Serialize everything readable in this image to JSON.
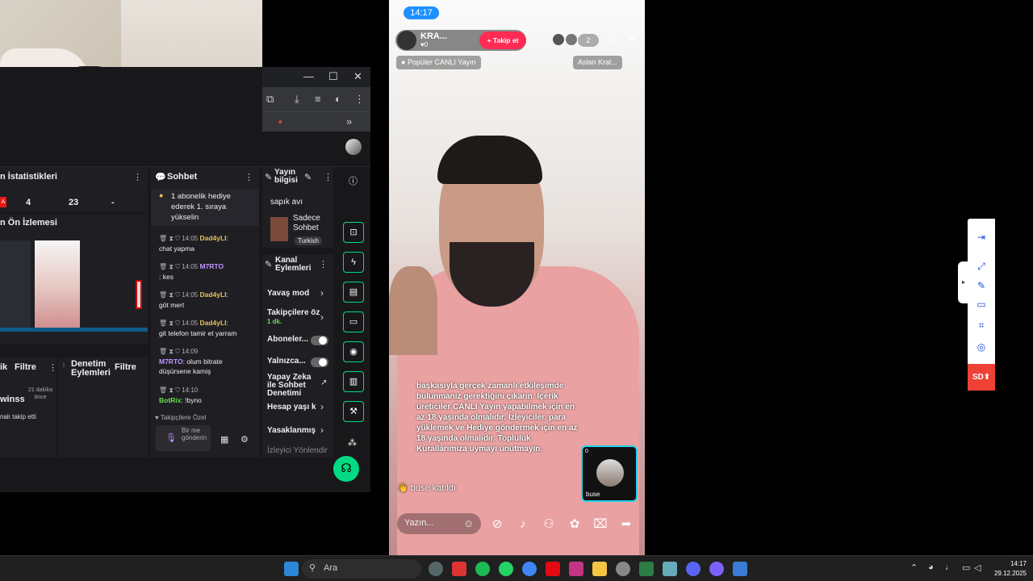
{
  "dashboard": {
    "stats_title": "n İstatistikleri",
    "stats": [
      "4",
      "23",
      "-"
    ],
    "live_badge": "A",
    "preview_title": "n Ön İzlemesi",
    "filter_label": "Filtre",
    "filter_left": "ik",
    "denetim_title": "Denetim Eylemleri",
    "activity_user": "winss",
    "activity_time": "21 dakika önce",
    "activity_text": "nalı takip etti"
  },
  "chat": {
    "title": "Sohbet",
    "pinned": "1 abonelik hediye ederek 1. sıraya yükselin",
    "messages": [
      {
        "time": "14:05",
        "user": "Dad4yLI",
        "text": "chat yapma",
        "color": "y"
      },
      {
        "time": "14:05",
        "user": "M7RTO",
        "text": ": kes",
        "color": "p"
      },
      {
        "time": "14:05",
        "user": "Dad4yLI",
        "text": "göt mert",
        "color": "y"
      },
      {
        "time": "14:05",
        "user": "Dad4yLI",
        "text": "git telefon tamir et yarram",
        "color": "y"
      },
      {
        "time": "14:09",
        "user": "M7RTO",
        "text": ": olum bitrate düşürsene kamiş",
        "color": "p"
      },
      {
        "time": "14:10",
        "user": "BotRix",
        "text": ": !byno",
        "color": "g"
      }
    ],
    "followers_only": "Takipçilere Özel",
    "input_placeholder": "Bir me gönderin"
  },
  "stream_info": {
    "title": "Yayın bilgisi",
    "stream_name": "sapık avı",
    "category": "Sadece Sohbet",
    "language": "Turkish"
  },
  "channel_actions": {
    "title": "Kanal Eylemleri",
    "slow_mode": "Yavaş mod",
    "followers": "Takipçilere öz",
    "followers_sub": "1 dk.",
    "subscribers": "Aboneler...",
    "only": "Yalnızca...",
    "ai_moderation": "Yapay Zeka ile Sohbet Denetimi",
    "account_age": "Hesap yaşı k",
    "banned": "Yasaklanmış",
    "viewer_redirect": "İzleyici Yönlendir"
  },
  "phone": {
    "time": "14:17",
    "streamer": "KRA...",
    "likes": "0",
    "follow": "Takip et",
    "viewers": "2",
    "tag_left": "Popüler CANLI Yayın",
    "tag_right": "Aslan Kral...",
    "notice": "başkasıyla gerçek zamanlı etkileşimde bulunmanız gerektiğini çıkarın. İçerik üreticiler CANLI Yayın yapabilmek için en az 18 yaşında olmalıdır. İzleyiciler, para yüklemek ve Hediye göndermek için en az 18 yaşında olmalıdır. Topluluk Kurallarımıza uymayı unutmayın.",
    "joined": "buse katıldı",
    "guest_name": "buse",
    "guest_count": "0",
    "comment_placeholder": "Yazın..."
  },
  "right_toolbar": {
    "sd_label": "SD"
  },
  "taskbar": {
    "search_placeholder": "Ara",
    "time": "14:17",
    "date": "29.12.2025"
  }
}
